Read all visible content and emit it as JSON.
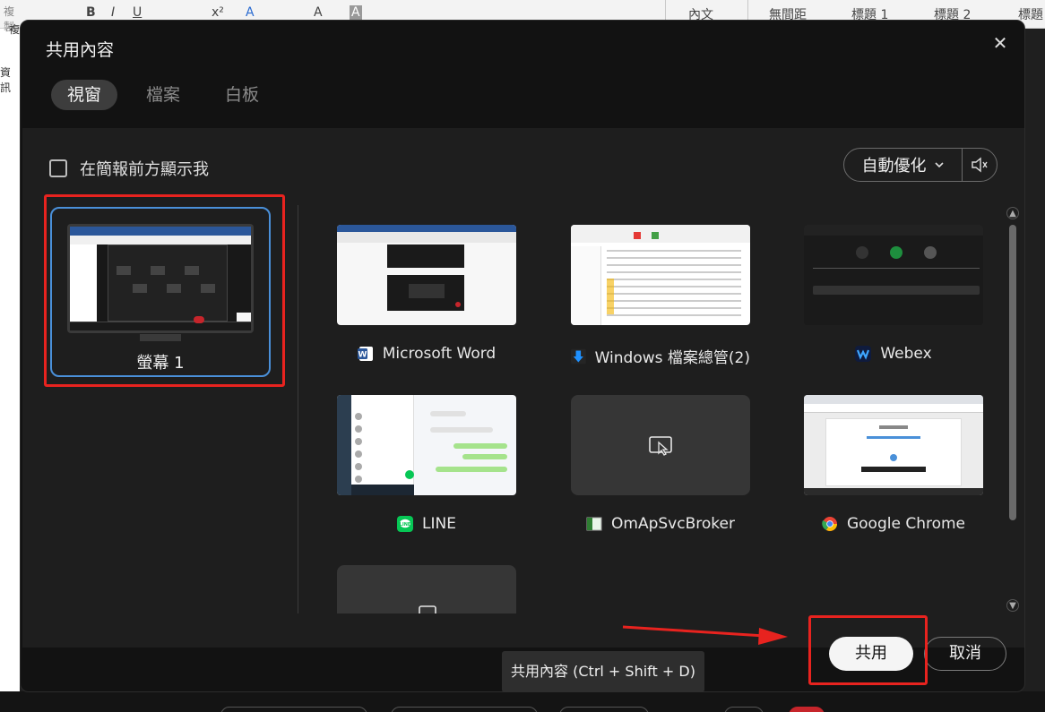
{
  "background": {
    "ribbon_tabs": [
      "內文",
      "無間距",
      "標題 1",
      "標題 2",
      "標題"
    ],
    "left_text": [
      "複製",
      "複",
      "資訊"
    ]
  },
  "dialog": {
    "title": "共用內容",
    "close_glyph": "✕",
    "tabs": [
      {
        "label": "視窗",
        "active": true
      },
      {
        "label": "檔案",
        "active": false
      },
      {
        "label": "白板",
        "active": false
      }
    ],
    "show_me_label": "在簡報前方顯示我",
    "show_me_checked": false,
    "optimize": {
      "selected": "自動優化"
    },
    "screen": {
      "label": "螢幕 1",
      "selected": true
    },
    "apps": [
      {
        "label": "Microsoft Word",
        "icon": "word-icon",
        "icon_color": "#2b579a"
      },
      {
        "label": "Windows 檔案總管(2)",
        "icon": "download-arrow-icon",
        "icon_color": "#1e90ff"
      },
      {
        "label": "Webex",
        "icon": "webex-icon",
        "icon_color": "#1b5fd3"
      },
      {
        "label": "LINE",
        "icon": "line-icon",
        "icon_color": "#06c755"
      },
      {
        "label": "OmApSvcBroker",
        "icon": "app-window-icon",
        "icon_color": "#2e7d32"
      },
      {
        "label": "Google Chrome",
        "icon": "chrome-icon",
        "icon_color": "#ea4335"
      }
    ],
    "share_label": "共用",
    "cancel_label": "取消",
    "tooltip": "共用內容 (Ctrl + Shift + D)"
  },
  "colors": {
    "selected_border": "#4a90d9",
    "annotation_red": "#e8231f"
  }
}
